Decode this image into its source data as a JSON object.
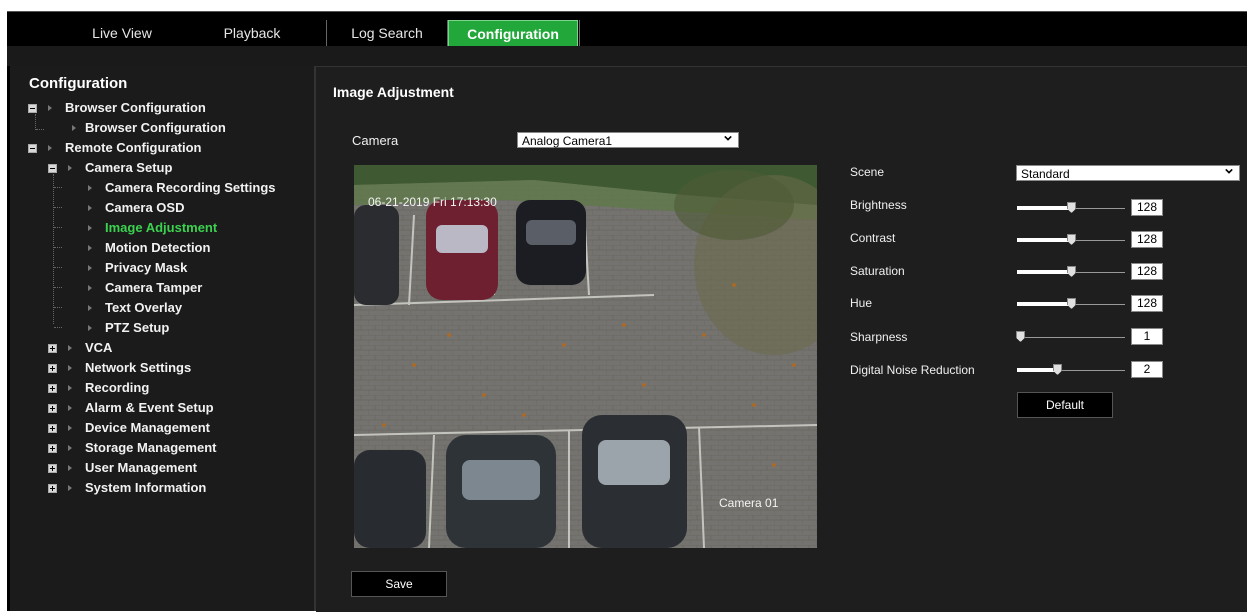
{
  "nav": {
    "tabs": [
      {
        "label": "Live View"
      },
      {
        "label": "Playback"
      },
      {
        "label": "Log Search"
      },
      {
        "label": "Configuration"
      }
    ]
  },
  "sidebar": {
    "title": "Configuration",
    "items": [
      {
        "label": "Browser Configuration"
      },
      {
        "label": "Browser Configuration"
      },
      {
        "label": "Remote Configuration"
      },
      {
        "label": "Camera Setup"
      },
      {
        "label": "Camera Recording Settings"
      },
      {
        "label": "Camera OSD"
      },
      {
        "label": "Image Adjustment"
      },
      {
        "label": "Motion Detection"
      },
      {
        "label": "Privacy Mask"
      },
      {
        "label": "Camera Tamper"
      },
      {
        "label": "Text Overlay"
      },
      {
        "label": "PTZ Setup"
      },
      {
        "label": "VCA"
      },
      {
        "label": "Network Settings"
      },
      {
        "label": "Recording"
      },
      {
        "label": "Alarm & Event Setup"
      },
      {
        "label": "Device Management"
      },
      {
        "label": "Storage Management"
      },
      {
        "label": "User Management"
      },
      {
        "label": "System Information"
      }
    ]
  },
  "main": {
    "title": "Image Adjustment",
    "camera_label": "Camera",
    "camera_value": "Analog Camera1",
    "preview": {
      "timestamp": "06-21-2019 Fri 17:13:30",
      "camera_name": "Camera 01"
    },
    "save_label": "Save",
    "scene_label": "Scene",
    "scene_value": "Standard",
    "sliders": [
      {
        "label": "Brightness",
        "value": "128",
        "level": 0.5
      },
      {
        "label": "Contrast",
        "value": "128",
        "level": 0.5
      },
      {
        "label": "Saturation",
        "value": "128",
        "level": 0.5
      },
      {
        "label": "Hue",
        "value": "128",
        "level": 0.5
      },
      {
        "label": "Sharpness",
        "value": "1",
        "level": 0.03
      },
      {
        "label": "Digital Noise Reduction",
        "value": "2",
        "level": 0.37
      }
    ],
    "default_label": "Default"
  },
  "colors": {
    "accent": "#22a83a",
    "active_text": "#3bd24f",
    "panel_bg": "#1e1e1e"
  }
}
